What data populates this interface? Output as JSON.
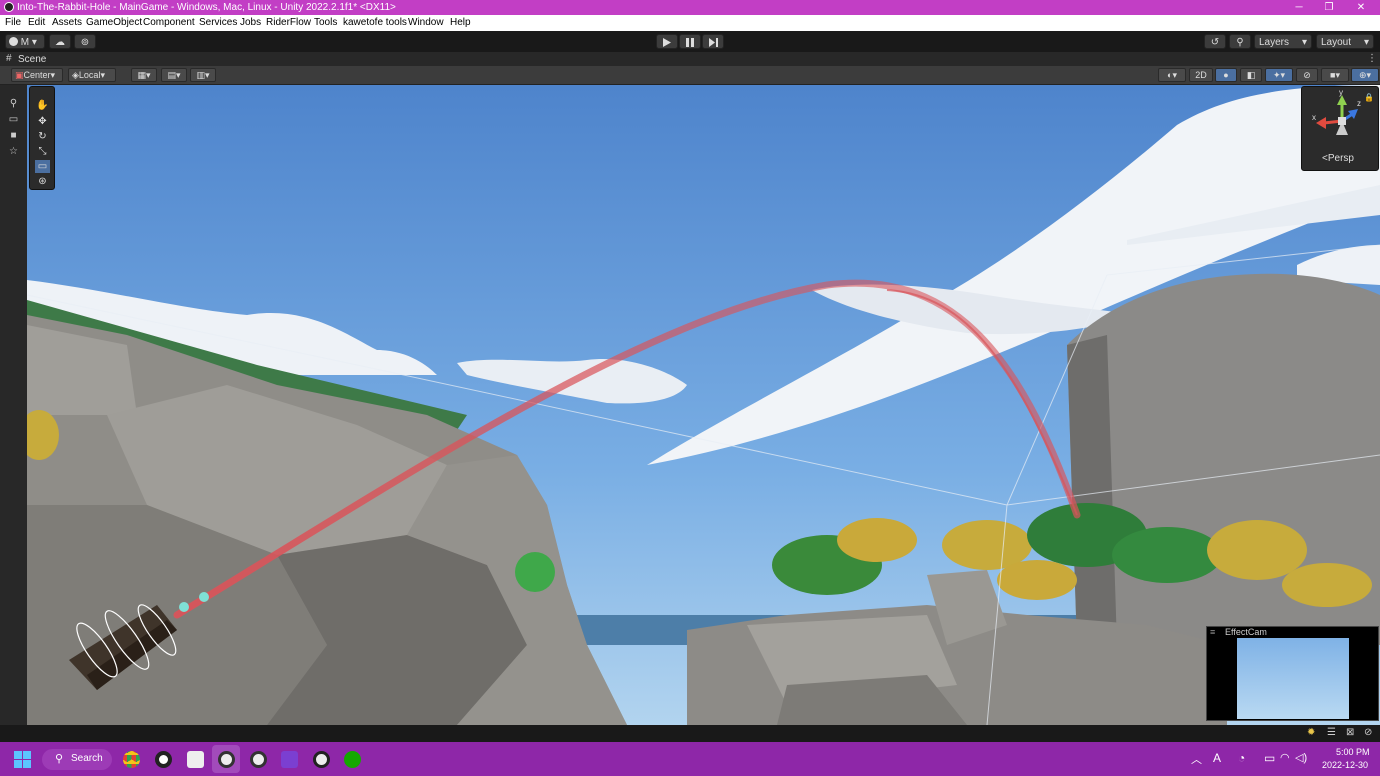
{
  "window": {
    "title": "Into-The-Rabbit-Hole - MainGame - Windows, Mac, Linux - Unity 2022.2.1f1* <DX11>",
    "controls": [
      "─",
      "❐",
      "✕"
    ]
  },
  "menu": [
    "File",
    "Edit",
    "Assets",
    "GameObject",
    "Component",
    "Services",
    "Jobs",
    "RiderFlow",
    "Tools",
    "kawetofe tools",
    "Window",
    "Help"
  ],
  "toolbar": {
    "account_label": "M",
    "play_icon": "play-icon",
    "pause_icon": "pause-icon",
    "step_icon": "step-icon",
    "layers_label": "Layers",
    "layout_label": "Layout"
  },
  "scene_tab": {
    "label": "Scene",
    "more": "⋮"
  },
  "scene_toolbar": {
    "pivot_label": "Center",
    "space_label": "Local",
    "mode_2d_label": "2D"
  },
  "gizmo": {
    "axis_x": "x",
    "axis_y": "y",
    "axis_z": "z",
    "projection_label": "Persp"
  },
  "effect_cam": {
    "title": "EffectCam"
  },
  "taskbar": {
    "search_label": "Search",
    "clock_time": "5:00 PM",
    "clock_date": "2022-12-30",
    "tray_language": "A"
  },
  "colors": {
    "title_bar": "#c23ec5",
    "taskbar": "#8e27a8",
    "sky": "#5b90d4",
    "trajectory": "#d9545a",
    "target_marker": "#3fa84a"
  }
}
